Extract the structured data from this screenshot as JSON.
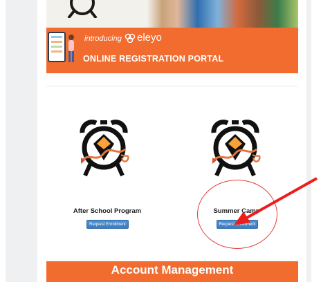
{
  "hero": {
    "intro": "introducing",
    "brand": "eleyo",
    "title": "ONLINE REGISTRATION PORTAL"
  },
  "programs": [
    {
      "name": "After School Program",
      "button_label": "Request Enrollment"
    },
    {
      "name": "Summer Camp",
      "button_label": "Request Enrollment"
    }
  ],
  "account": {
    "title": "Account Management"
  },
  "colors": {
    "brand_orange": "#f26c2f",
    "button_blue": "#3b7bbf",
    "annotation_red": "#e53c3c"
  },
  "icons": [
    "alarm-clock-icon",
    "eleyo-logo-icon",
    "tablet-icon"
  ]
}
